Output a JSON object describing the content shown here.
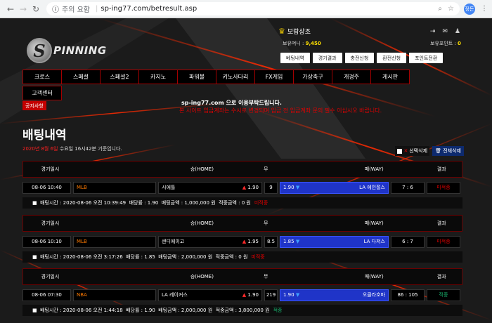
{
  "browser": {
    "security_label": "주의 요함",
    "url": "sp-ing77.com/betresult.asp",
    "profile_label": "정돈"
  },
  "site": {
    "logo_letter": "S",
    "logo_text": "PINNING"
  },
  "user": {
    "name": "보람상조",
    "money_label": "보유머니 :",
    "money_value": "9,450",
    "points_label": "보유포인트 :",
    "points_value": "0"
  },
  "sub_buttons": [
    "베팅내역",
    "경기결과",
    "충전신청",
    "환전신청",
    "포인트전환"
  ],
  "menu": [
    "크로스",
    "스페셜",
    "스페셜2",
    "카지노",
    "파워볼",
    "키노사다리",
    "FX게임",
    "가상축구",
    "개경주",
    "게시판"
  ],
  "menu_row2": "고객센터",
  "notice_button": "공지사항",
  "ticker": {
    "line1": "sp-ing77.com 으로 이용부탁드립니다.",
    "line2": "본 사이트 입금계좌는 수시로 변경되며 입금 전 입금계좌 문의 필수 이십시오 바랍니다."
  },
  "page_title": "배팅내역",
  "date_line": {
    "highlight": "2020년 8월 6일",
    "rest": " 수요일 16시42분 기준입니다."
  },
  "actions": {
    "select_delete": "선택삭제",
    "delete_all": "전체삭제"
  },
  "columns": {
    "date": "경기일시",
    "home": "승(HOME)",
    "draw": "무",
    "away": "패(WAY)",
    "result": "결과"
  },
  "bets": [
    {
      "date": "08-06 10:40",
      "league": "MLB",
      "home": "시애틀",
      "home_odds": "1.90",
      "draw": "9",
      "away": "LA 에인절스",
      "away_odds": "1.90",
      "score": "7 : 6",
      "result": "미적중",
      "bet_time": "2020-08-06 오전 10:39:49",
      "odds": "1.90",
      "amount": "1,000,000",
      "win_amount": "0",
      "status": "미적중"
    },
    {
      "date": "08-06 10:10",
      "league": "MLB",
      "home": "샌디에이고",
      "home_odds": "1.95",
      "draw": "8.5",
      "away": "LA 다저스",
      "away_odds": "1.85",
      "score": "6 : 7",
      "result": "미적중",
      "bet_time": "2020-08-06 오전 3:17:26",
      "odds": "1.85",
      "amount": "2,000,000",
      "win_amount": "0",
      "status": "미적중"
    },
    {
      "date": "08-06 07:30",
      "league": "NBA",
      "home": "LA 레이커스",
      "home_odds": "1.90",
      "draw": "219",
      "away": "오클라호마",
      "away_odds": "1.90",
      "score": "86 : 105",
      "result": "적중",
      "bet_time": "2020-08-06 오전 1:44:18",
      "odds": "1.90",
      "amount": "2,000,000",
      "win_amount": "3,800,000",
      "status": "적중"
    }
  ],
  "labels": {
    "bet_time": "배팅시간 :",
    "odds": "배당률 :",
    "amount": "배팅금액 :",
    "win_amount": "적중금액 :",
    "won": "원"
  },
  "colors": {
    "accent_red": "#c40000",
    "away_selected": "#1f34c8",
    "win_green": "#17b36d"
  }
}
